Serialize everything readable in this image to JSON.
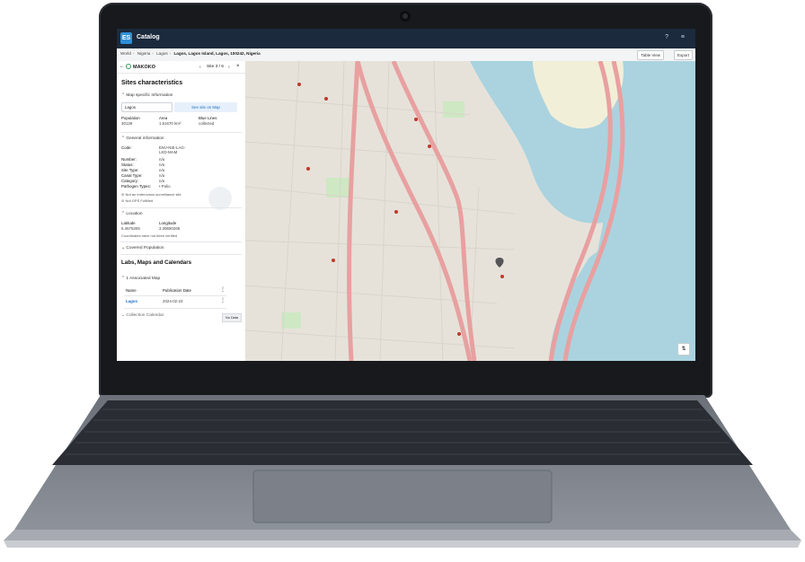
{
  "app": {
    "logo": "ES",
    "title": "Catalog",
    "top_icons": "? ≡"
  },
  "breadcrumb": {
    "items": [
      "World",
      "Nigeria",
      "Lagos"
    ],
    "current": "Lagos, Lagos Island, Lagos, 100242, Nigeria",
    "table_view": "Table View",
    "export": "Export"
  },
  "panel": {
    "site_name": "MAKOKO",
    "site_nav": "Site 3 / 6",
    "heading": "Sites characteristics",
    "map_specific": {
      "label": "Map specific Information",
      "input_value": "Lagos",
      "see_on_map": "See site on Map",
      "population_label": "Population",
      "population_value": "30129",
      "area_label": "Area",
      "area_value": "1.61670 km²",
      "blue_lines_label": "Blue Lines",
      "blue_lines_value": "collected"
    },
    "general": {
      "label": "General information",
      "code_label": "Code:",
      "code_value": "ENV-NIE-LAG-LKD-MAM",
      "number_label": "Number:",
      "number_value": "n/a",
      "status_label": "Status:",
      "status_value": "n/a",
      "site_type_label": "Site Type:",
      "site_type_value": "n/a",
      "canal_type_label": "Canal Type:",
      "canal_type_value": "n/a",
      "category_label": "Category:",
      "category_value": "n/a",
      "pathogen_label": "Pathogen Types:",
      "pathogen_value": "Polio",
      "note1": "Not an enterovirus surveillance site",
      "note2": "Not GPS Fulfilled"
    },
    "location": {
      "label": "Location",
      "lat_label": "Latitude",
      "lat_value": "6.4675305",
      "lon_label": "Longitude",
      "lon_value": "3.39650266",
      "note": "Coordinates have not been verified"
    },
    "covered_population": "Covered Population",
    "labs_heading": "Labs, Maps and Calendars",
    "associated_map": "1 Associated Map",
    "table_headers": [
      "Name",
      "Publication Date"
    ],
    "table_row": {
      "name": "Lagos",
      "date": "2024-02-23"
    },
    "collection_calendar": "Collection Calendar",
    "no_data": "No Data"
  },
  "colors": {
    "accent": "#1e6fc0",
    "topbar": "#1b2a3d",
    "water": "#aad3df"
  }
}
